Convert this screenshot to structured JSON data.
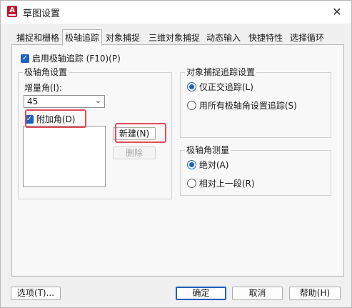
{
  "window": {
    "title": "草图设置",
    "app_icon_letter": "A"
  },
  "tabs": [
    {
      "label": "捕捉和栅格",
      "active": false
    },
    {
      "label": "极轴追踪",
      "active": true
    },
    {
      "label": "对象捕捉",
      "active": false
    },
    {
      "label": "三维对象捕捉",
      "active": false
    },
    {
      "label": "动态输入",
      "active": false
    },
    {
      "label": "快捷特性",
      "active": false
    },
    {
      "label": "选择循环",
      "active": false
    }
  ],
  "polar": {
    "enable_label": "启用极轴追踪 (F10)(P)",
    "enable_checked": true,
    "angle_settings": {
      "title": "极轴角设置",
      "increment_label": "增量角(I):",
      "increment_value": "45",
      "additional_label": "附加角(D)",
      "additional_checked": true,
      "new_button": "新建(N)",
      "delete_button": "删除"
    },
    "snap_tracking": {
      "title": "对象捕捉追踪设置",
      "options": [
        {
          "label": "仅正交追踪(L)",
          "checked": true
        },
        {
          "label": "用所有极轴角设置追踪(S)",
          "checked": false
        }
      ]
    },
    "measurement": {
      "title": "极轴角测量",
      "options": [
        {
          "label": "绝对(A)",
          "checked": true
        },
        {
          "label": "相对上一段(R)",
          "checked": false
        }
      ]
    }
  },
  "footer": {
    "options_button": "选项(T)...",
    "ok_button": "确定",
    "cancel_button": "取消",
    "help_button": "帮助(H)"
  },
  "icons": {
    "check": "✓",
    "close": "✕",
    "dropdown": "⌄"
  },
  "colors": {
    "accent": "#1f5fbf",
    "highlight": "#e24b5c",
    "app_icon": "#c8102e"
  }
}
